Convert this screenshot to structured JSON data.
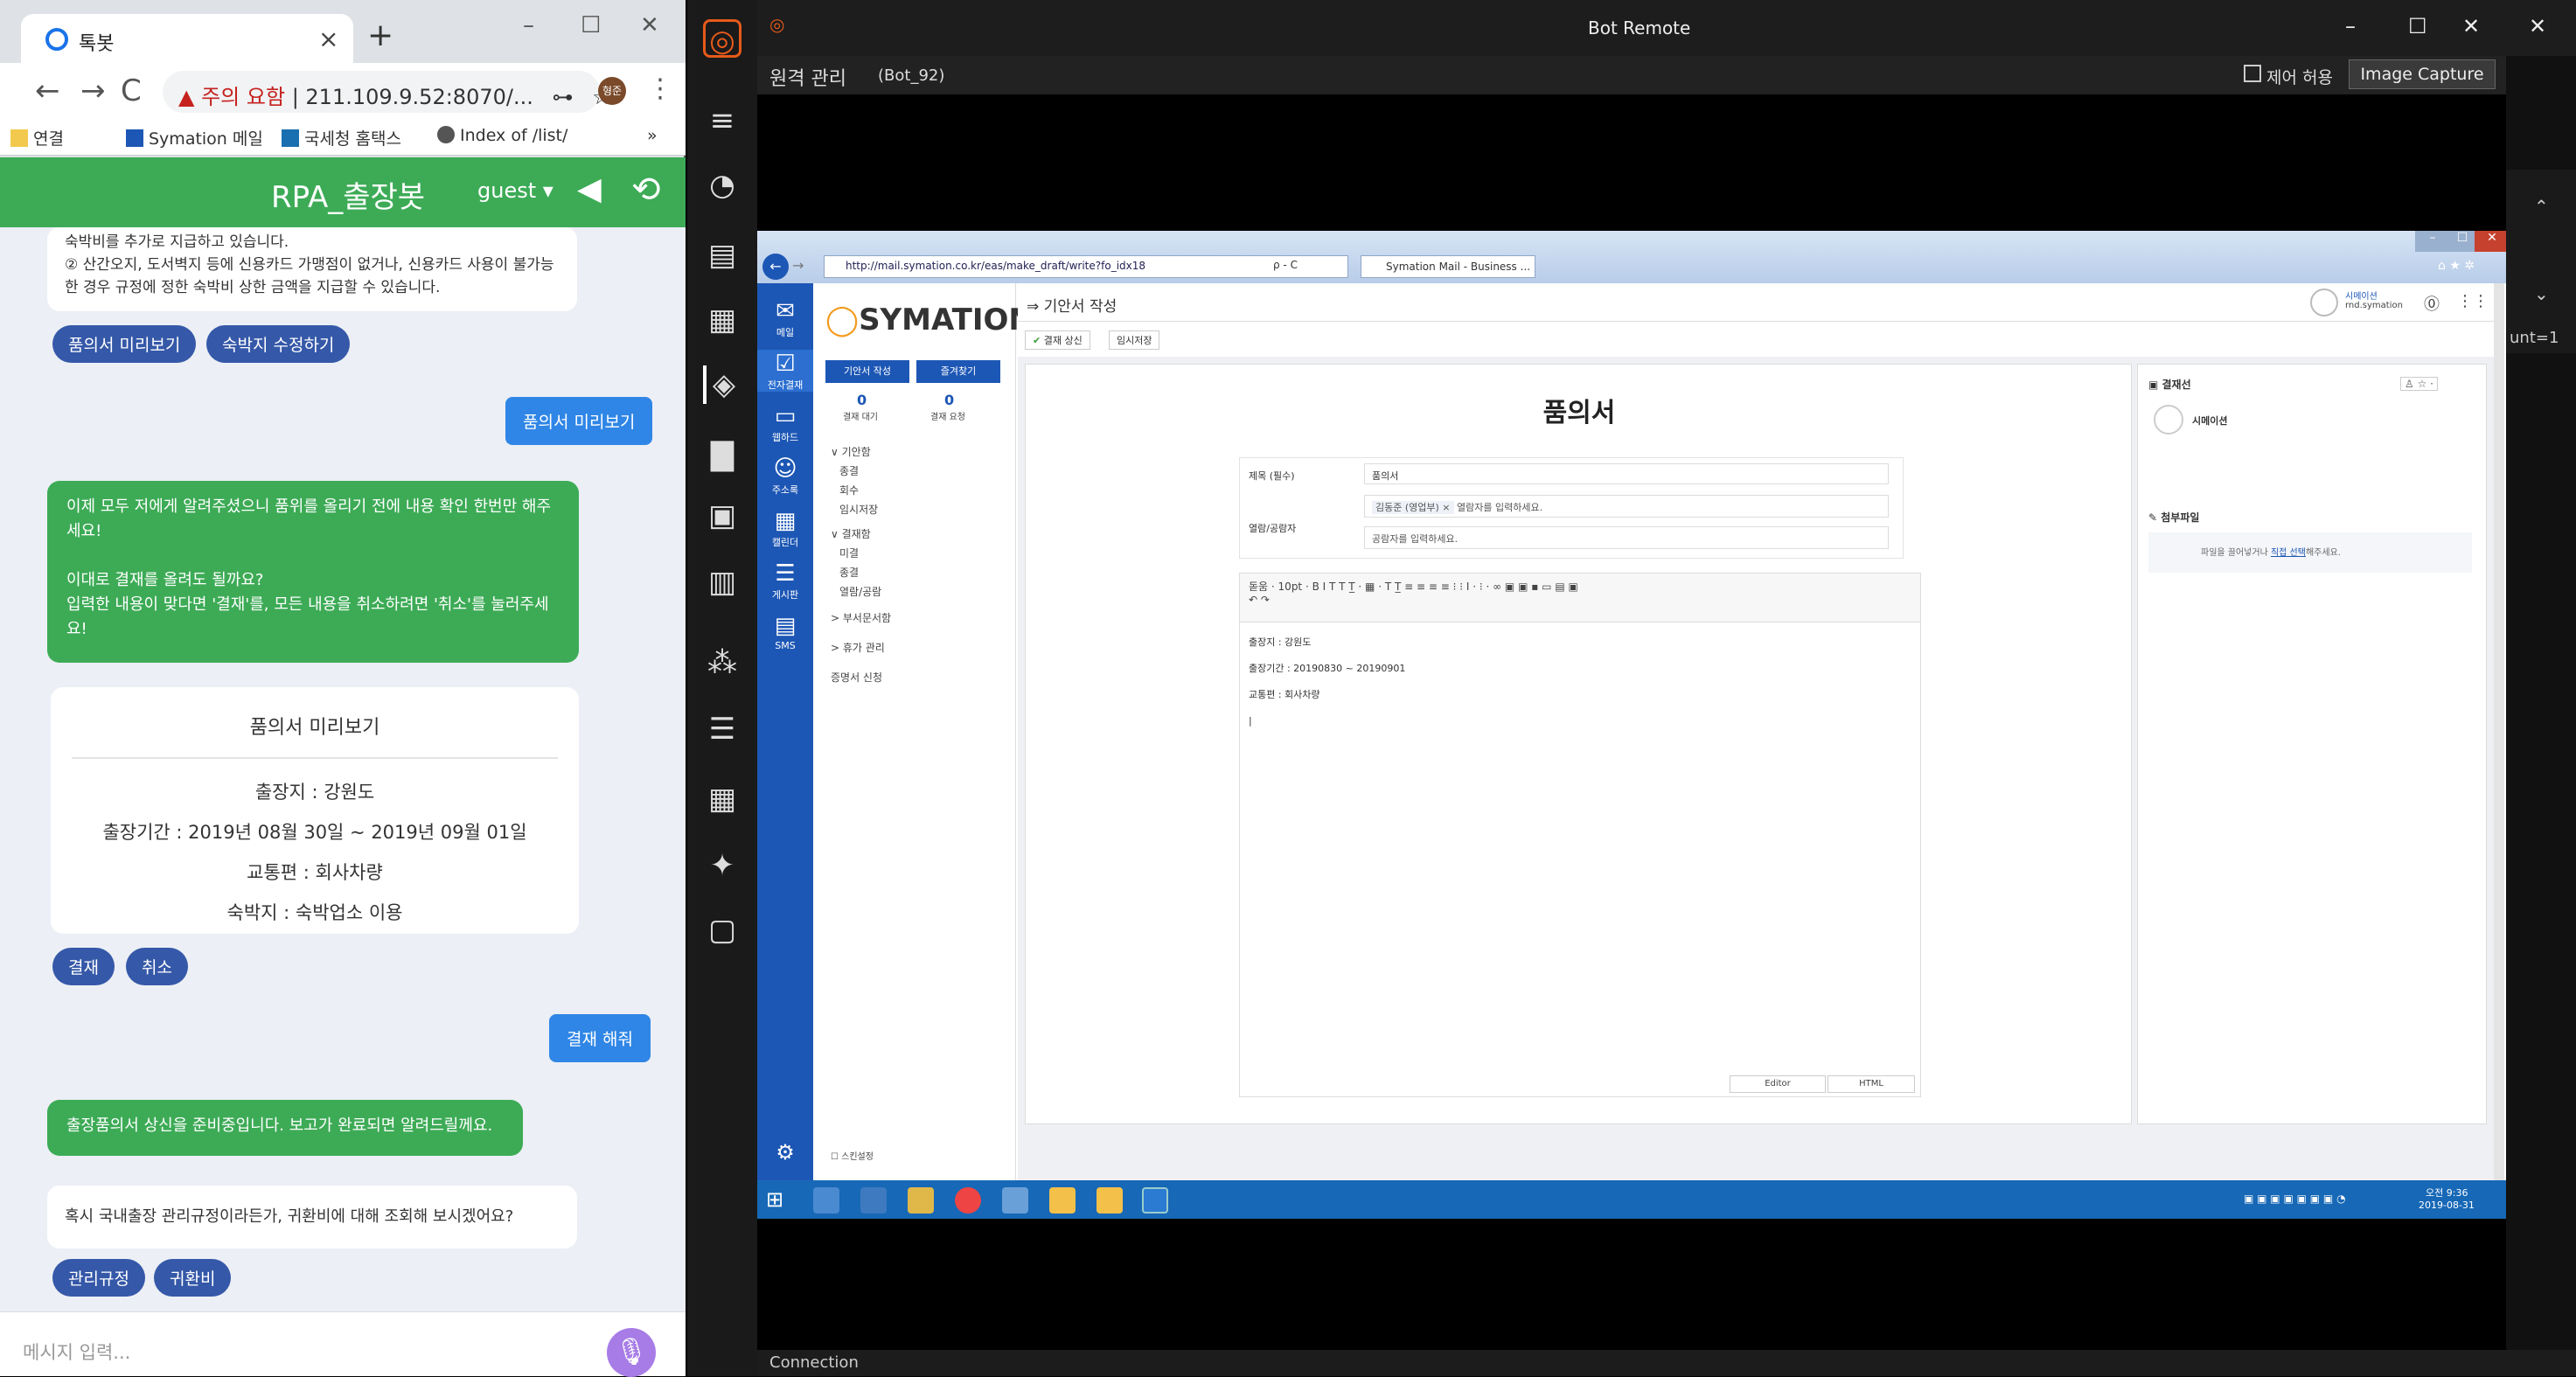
{
  "browser": {
    "tab_title": "톡봇",
    "tab_close": "×",
    "new_tab": "+",
    "window_controls": [
      "–",
      "☐",
      "✕"
    ],
    "address_warning": "주의 요함",
    "address_url": "211.109.9.52:8070/...",
    "profile": "형준",
    "bookmarks": [
      "연결",
      "Symation 메일",
      "국세청 홈택스",
      "Index of /list/"
    ],
    "bookmarks_more": "»"
  },
  "bot": {
    "title": "RPA_출장봇",
    "user": "guest ▾",
    "msg_top": "숙박비를 추가로 지급하고 있습니다.\n② 산간오지, 도서벽지 등에 신용카드 가맹점이 없거나, 신용카드 사용이 불가능한 경우 규정에 정한 숙박비 상한 금액을 지급할 수 있습니다.",
    "pills1": [
      "품의서 미리보기",
      "숙박지 수정하기"
    ],
    "user_msg1": "품의서 미리보기",
    "bot_msg1_a": "이제 모두 저에게 알려주셨으니 품위를 올리기 전에 내용 확인 한번만 해주세요!",
    "bot_msg1_b": "이대로 결재를 올려도 될까요?\n입력한 내용이 맞다면 '결재'를, 모든 내용을 취소하려면 '취소'를 눌러주세요!",
    "card": {
      "title": "품의서 미리보기",
      "rows": [
        "출장지   : 강원도",
        "출장기간 : 2019년 08월 30일 ~ 2019년 09월 01일",
        "교통편   : 회사차량",
        "숙박지   : 숙박업소 이용"
      ]
    },
    "pills2": [
      "결재",
      "취소"
    ],
    "user_msg2": "결재 해줘",
    "bot_msg2": "출장품의서 상신을 준비중입니다. 보고가 완료되면 알려드릴께요.",
    "bot_msg3": "혹시 국내출장 관리규정이라든가, 귀환비에 대해 조회해 보시겠어요?",
    "pills3": [
      "관리규정",
      "귀환비"
    ],
    "input_placeholder": "메시지 입력..."
  },
  "remote": {
    "title": "Bot Remote",
    "subtitle": "원격 관리",
    "bot_id": "(Bot_92)",
    "control_label": "제어 허용",
    "capture": "Image Capture",
    "window_controls": [
      "–",
      "☐",
      "✕",
      "✕"
    ],
    "side_label": "unt=1",
    "footer": "Connection"
  },
  "ie": {
    "url": "http://mail.symation.co.kr/eas/make_draft/write?fo_idx18",
    "search": "ρ - C",
    "tab": "Symation Mail - Business ...",
    "window_controls": [
      "–",
      "☐",
      "✕"
    ]
  },
  "mail": {
    "brand": "SYMATION",
    "nav": [
      "메일",
      "전자결재",
      "웹하드",
      "주소록",
      "캘린더",
      "게시판",
      "SMS"
    ],
    "btn_write": "기안서 작성",
    "btn_fav": "즐겨찾기",
    "counts": [
      {
        "value": "0",
        "label": "결재 대기"
      },
      {
        "value": "0",
        "label": "결재 요청"
      }
    ],
    "menu": [
      "∨ 기안함",
      "종결",
      "회수",
      "임시저장",
      "∨ 결재함",
      "미결",
      "종결",
      "열람/공람",
      "> 부서문서함",
      "> 휴가 관리",
      "증명서 신청"
    ],
    "menu_bottom": "스킨설정",
    "page_title": "기안서 작성",
    "action_submit": "결재 상신",
    "action_save": "임시저장",
    "user_name": "시메이션",
    "user_id": "rnd.symation",
    "doc_title": "품의서",
    "form": {
      "subject_label": "제목 (필수)",
      "subject_value": "품의서",
      "ref_label": "열람/공람자",
      "ref_tag": "김동준 (영업부) ×",
      "ref_placeholder": "열람자를 입력하세요.",
      "ref_placeholder2": "공람자를 입력하세요."
    },
    "editor": {
      "font": "돋움",
      "size": "10pt",
      "lines": [
        "출장지 : 강원도",
        "출장기간 : 20190830 ~ 20190901",
        "교통편 : 회사차량"
      ],
      "tab_editor": "Editor",
      "tab_html": "HTML"
    },
    "approval_title": "결재선",
    "approver": "시메이션",
    "attach_title": "첨부파일",
    "attach_hint": "파일을 끌어넣거나",
    "attach_link": "직접 선택",
    "attach_hint2": "해주세요."
  },
  "taskbar": {
    "time": "오전 9:36",
    "date": "2019-08-31"
  },
  "colors": {
    "bot_green": "#3dab56",
    "pill_blue": "#3558a8",
    "user_blue": "#2f86e6",
    "mail_nav": "#1d57b5",
    "taskbar": "#1768b6"
  }
}
